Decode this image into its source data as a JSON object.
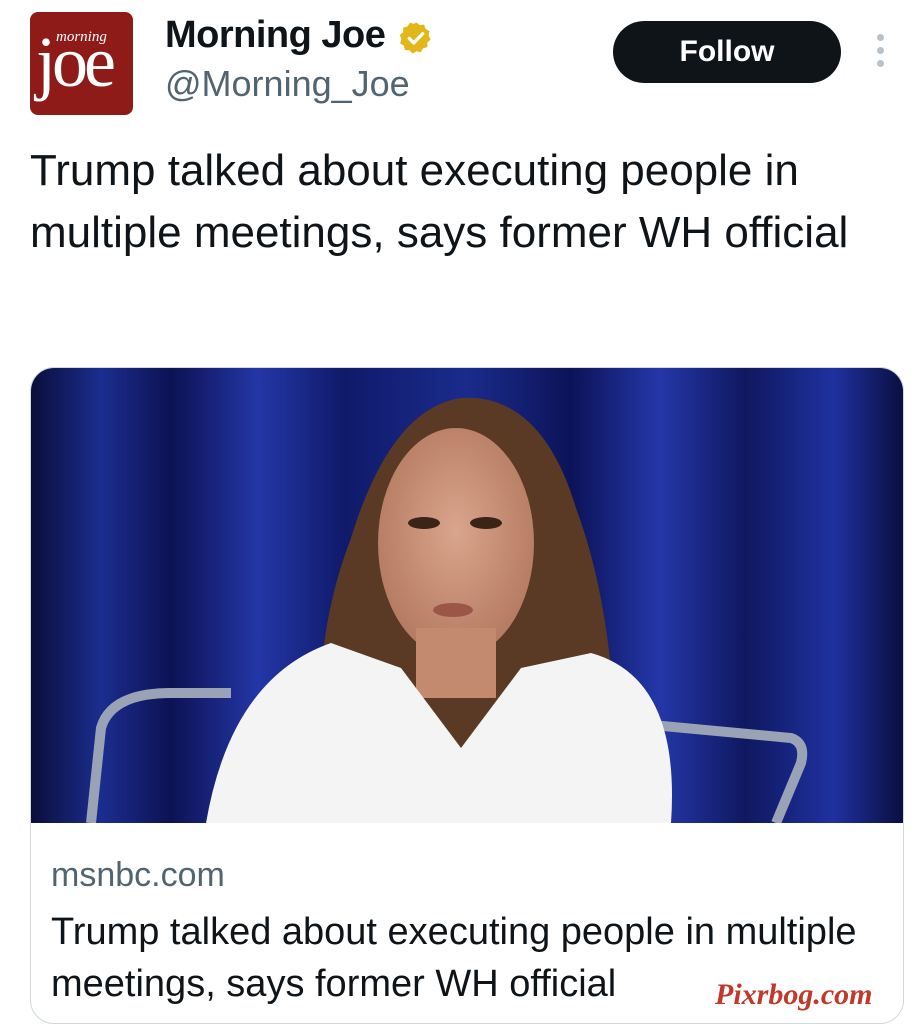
{
  "tweet": {
    "avatar_small": "morning",
    "avatar_big": "joe",
    "display_name": "Morning Joe",
    "handle": "@Morning_Joe",
    "follow_label": "Follow",
    "verified_icon": "verified-badge-gold",
    "more_icon": "vertical-ellipsis",
    "text": "Trump talked about executing people in multiple meetings, says former WH official"
  },
  "card": {
    "domain": "msnbc.com",
    "title": "Trump talked about executing people in multiple meetings, says former WH official",
    "image_description_icon": "photo"
  },
  "watermark": "Pixrbog.com",
  "colors": {
    "follow_bg": "#0f1419",
    "avatar_bg": "#8e1b17",
    "verified": "#e2b719",
    "muted_text": "#536471"
  }
}
